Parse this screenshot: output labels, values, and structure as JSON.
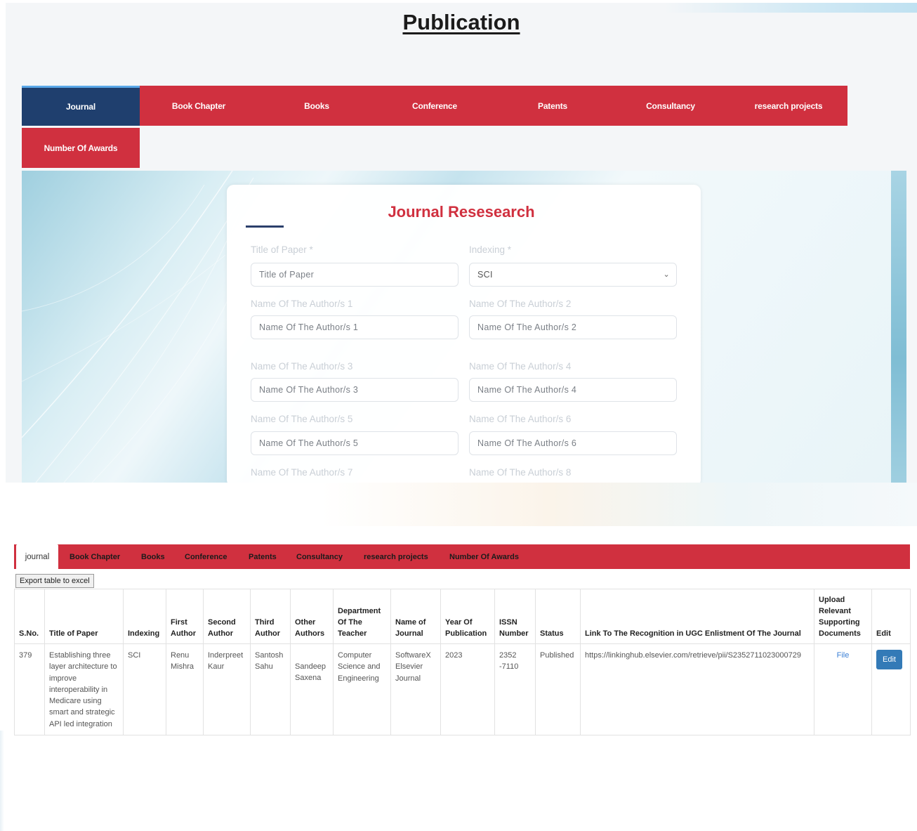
{
  "page": {
    "title": "Publication"
  },
  "top_nav": [
    {
      "label": "Journal",
      "active": true
    },
    {
      "label": "Book Chapter",
      "active": false
    },
    {
      "label": "Books",
      "active": false
    },
    {
      "label": "Conference",
      "active": false
    },
    {
      "label": "Patents",
      "active": false
    },
    {
      "label": "Consultancy",
      "active": false
    },
    {
      "label": "research projects",
      "active": false
    },
    {
      "label": "Number Of Awards",
      "active": false
    }
  ],
  "form": {
    "title": "Journal Resesearch",
    "fields": [
      {
        "label": "Title of Paper *",
        "placeholder": "Title of Paper"
      },
      {
        "label": "Indexing *",
        "value": "SCI",
        "type": "select"
      },
      {
        "label": "Name Of The Author/s 1",
        "placeholder": "Name Of The Author/s 1"
      },
      {
        "label": "Name Of The Author/s 2",
        "placeholder": "Name Of The Author/s 2"
      },
      {
        "label": "Name Of The Author/s 3",
        "placeholder": "Name Of The Author/s 3"
      },
      {
        "label": "Name Of The Author/s 4",
        "placeholder": "Name Of The Author/s 4"
      },
      {
        "label": "Name Of The Author/s 5",
        "placeholder": "Name Of The Author/s 5"
      },
      {
        "label": "Name Of The Author/s 6",
        "placeholder": "Name Of The Author/s 6"
      },
      {
        "label": "Name Of The Author/s 7"
      },
      {
        "label": "Name Of The Author/s 8"
      }
    ]
  },
  "tabs": [
    {
      "label": "journal",
      "active": true
    },
    {
      "label": "Book Chapter"
    },
    {
      "label": "Books"
    },
    {
      "label": "Conference"
    },
    {
      "label": "Patents"
    },
    {
      "label": "Consultancy"
    },
    {
      "label": "research projects"
    },
    {
      "label": "Number Of Awards"
    }
  ],
  "export_label": "Export table to excel",
  "table": {
    "headers": [
      "S.No.",
      "Title of Paper",
      "Indexing",
      "First Author",
      "Second Author",
      "Third Author",
      "Other Authors",
      "Department Of The Teacher",
      "Name of Journal",
      "Year Of Publication",
      "ISSN Number",
      "Status",
      "Link To The Recognition in UGC Enlistment Of The Journal",
      "Upload Relevant Supporting Documents",
      "Edit"
    ],
    "rows": [
      {
        "sno": "379",
        "title": "Establishing three layer architecture to improve interoperability in Medicare using smart and strategic API led integration",
        "indexing": "SCI",
        "first_author": "Renu Mishra",
        "second_author": "Inderpreet Kaur",
        "third_author": "Santosh Sahu",
        "other_authors": "Sandeep Saxena",
        "department": "Computer Science and Engineering",
        "journal": "SoftwareX Elsevier Journal",
        "year": "2023",
        "issn": "2352 -7110",
        "status": "Published",
        "link": "https://linkinghub.elsevier.com/retrieve/pii/S2352711023000729",
        "document": "File",
        "edit": "Edit"
      }
    ]
  },
  "colors": {
    "accent_red": "#d0303f",
    "active_navy": "#1f3f6e",
    "link_blue": "#3a7fd5",
    "button_blue": "#337ab7"
  }
}
